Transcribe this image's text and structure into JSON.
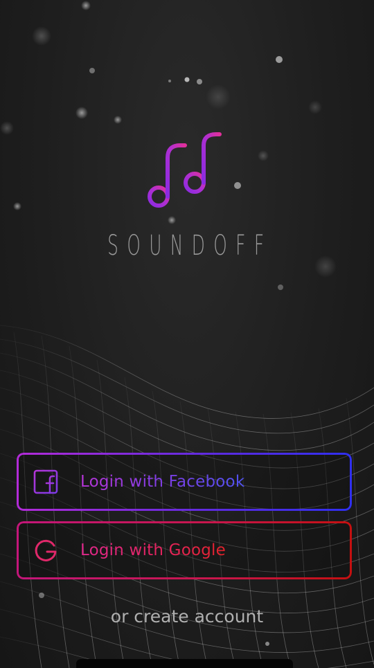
{
  "app": {
    "brand_name": "SOUNDOFF",
    "logo_icon": "music-notes-icon"
  },
  "auth": {
    "facebook_label": "Login with Facebook",
    "facebook_icon": "facebook-icon",
    "google_label": "Login with Google",
    "google_icon": "google-icon",
    "create_account_label": "or create account"
  },
  "colors": {
    "facebook_gradient": [
      "#b32bd8",
      "#2f2ff0"
    ],
    "google_gradient": [
      "#c4167a",
      "#c51010"
    ],
    "logo_gradient": [
      "#8a2be2",
      "#e0309b"
    ],
    "background": "#1c1c1c"
  }
}
